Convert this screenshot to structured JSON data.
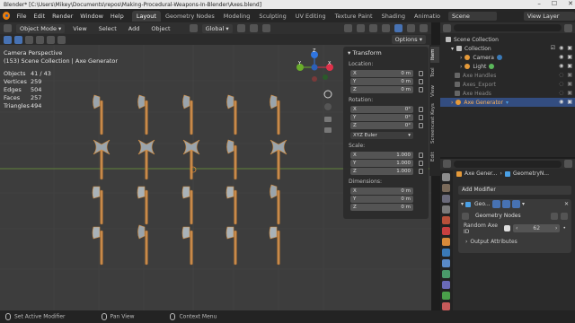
{
  "window_title": "Blender* [C:\\Users\\Mikey\\Documents\\repos\\Making-Procedural-Weapons-In-Blender\\Axes.blend]",
  "menus": [
    "File",
    "Edit",
    "Render",
    "Window",
    "Help"
  ],
  "workspaces": [
    "Layout",
    "Geometry Nodes",
    "Modeling",
    "Sculpting",
    "UV Editing",
    "Texture Paint",
    "Shading",
    "Animatio"
  ],
  "scene_label": "Scene",
  "view_layer_label": "View Layer",
  "viewport": {
    "mode": "Object Mode",
    "menu": [
      "View",
      "Select",
      "Add",
      "Object"
    ],
    "orientation": "Global",
    "options": "Options",
    "camera_label": "Camera Perspective",
    "collection_label": "(153) Scene Collection | Axe Generator",
    "stats": [
      {
        "label": "Objects",
        "value": "41 / 43"
      },
      {
        "label": "Vertices",
        "value": "259"
      },
      {
        "label": "Edges",
        "value": "504"
      },
      {
        "label": "Faces",
        "value": "257"
      },
      {
        "label": "Triangles",
        "value": "494"
      }
    ],
    "gizmo": {
      "x": "X",
      "y": "Y",
      "z": "Z"
    }
  },
  "npanel": {
    "title": "Transform",
    "location_label": "Location:",
    "location": [
      {
        "axis": "X",
        "value": "0 m"
      },
      {
        "axis": "Y",
        "value": "0 m"
      },
      {
        "axis": "Z",
        "value": "0 m"
      }
    ],
    "rotation_label": "Rotation:",
    "rotation": [
      {
        "axis": "X",
        "value": "0°"
      },
      {
        "axis": "Y",
        "value": "0°"
      },
      {
        "axis": "Z",
        "value": "0°"
      }
    ],
    "rotation_mode": "XYZ Euler",
    "scale_label": "Scale:",
    "scale": [
      {
        "axis": "X",
        "value": "1.000"
      },
      {
        "axis": "Y",
        "value": "1.000"
      },
      {
        "axis": "Z",
        "value": "1.000"
      }
    ],
    "dimensions_label": "Dimensions:",
    "dimensions": [
      {
        "axis": "X",
        "value": "0 m"
      },
      {
        "axis": "Y",
        "value": "0 m"
      },
      {
        "axis": "Z",
        "value": "0 m"
      }
    ],
    "tabs": [
      "Item",
      "Tool",
      "View",
      "Screencast Keys",
      "Edit"
    ]
  },
  "outliner": {
    "rows": [
      {
        "label": "Scene Collection",
        "indent": 0,
        "selected": false,
        "dim": false,
        "color": "#dcdcdc"
      },
      {
        "label": "Collection",
        "indent": 1,
        "selected": false,
        "dim": false,
        "color": "#dcdcdc"
      },
      {
        "label": "Camera",
        "indent": 2,
        "selected": false,
        "dim": false,
        "color": "#dcdcdc"
      },
      {
        "label": "Light",
        "indent": 2,
        "selected": false,
        "dim": false,
        "color": "#dcdcdc"
      },
      {
        "label": "Axe Handles",
        "indent": 1,
        "selected": false,
        "dim": true,
        "color": "#8a8a8a"
      },
      {
        "label": "Axes_Export",
        "indent": 1,
        "selected": false,
        "dim": true,
        "color": "#8a8a8a"
      },
      {
        "label": "Axe Heads",
        "indent": 1,
        "selected": false,
        "dim": true,
        "color": "#8a8a8a"
      },
      {
        "label": "Axe Generator",
        "indent": 1,
        "selected": true,
        "dim": false,
        "color": "#ffb35a"
      }
    ]
  },
  "properties": {
    "breadcrumb_object": "Axe Gener...",
    "breadcrumb_modifier": "GeometryN...",
    "add_modifier": "Add Modifier",
    "modifier_name": "Geo...",
    "node_group": "Geometry Nodes",
    "param_label": "Random Axe ID",
    "param_value": "62",
    "output_attributes": "Output Attributes"
  },
  "status": {
    "items": [
      "Set Active Modifier",
      "Pan View",
      "Context Menu"
    ]
  }
}
